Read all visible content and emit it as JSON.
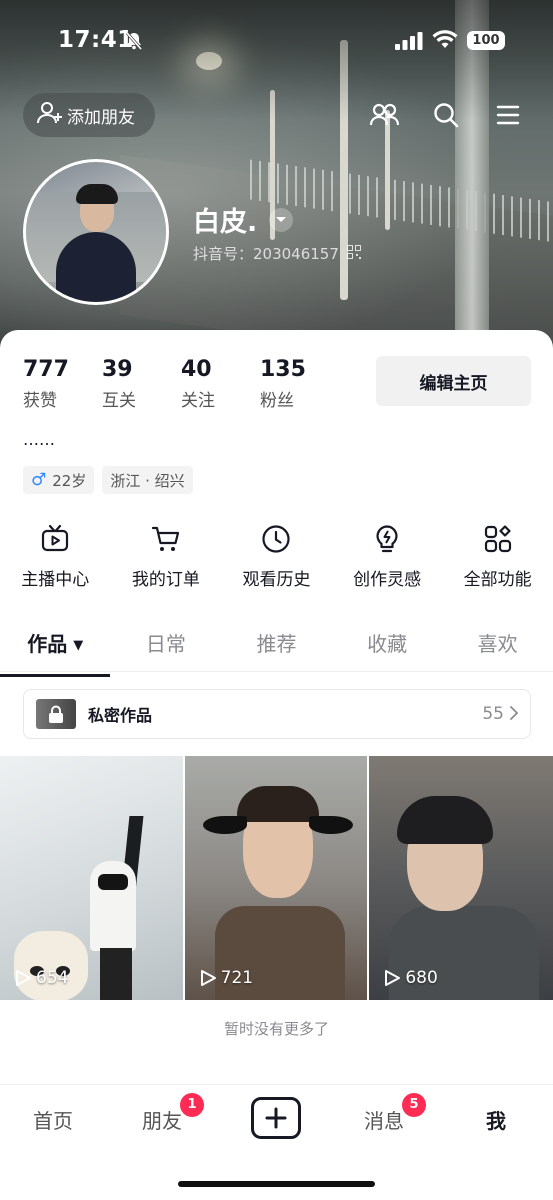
{
  "status_bar": {
    "time": "17:41",
    "battery": "100"
  },
  "header": {
    "add_friend_label": "添加朋友",
    "icons": [
      "friends-icon",
      "search-icon",
      "menu-icon"
    ]
  },
  "profile": {
    "name": "白皮.",
    "douyin_id": "抖音号：203046157"
  },
  "stats": [
    {
      "value": "777",
      "label": "获赞"
    },
    {
      "value": "39",
      "label": "互关"
    },
    {
      "value": "40",
      "label": "关注"
    },
    {
      "value": "135",
      "label": "粉丝"
    }
  ],
  "edit_button_label": "编辑主页",
  "bio": "……",
  "tags": {
    "gender_age": "22岁",
    "location": "浙江 · 绍兴"
  },
  "functions": [
    {
      "label": "主播中心",
      "icon": "tv-icon"
    },
    {
      "label": "我的订单",
      "icon": "cart-icon"
    },
    {
      "label": "观看历史",
      "icon": "clock-icon"
    },
    {
      "label": "创作灵感",
      "icon": "bulb-icon"
    },
    {
      "label": "全部功能",
      "icon": "grid-icon"
    }
  ],
  "tabs": [
    "作品",
    "日常",
    "推荐",
    "收藏",
    "喜欢"
  ],
  "private_works": {
    "label": "私密作品",
    "count": "55"
  },
  "videos": [
    {
      "views": "654"
    },
    {
      "views": "721"
    },
    {
      "views": "680"
    }
  ],
  "no_more_text": "暂时没有更多了",
  "bottom_nav": {
    "home": "首页",
    "friends": "朋友",
    "friends_badge": "1",
    "messages": "消息",
    "messages_badge": "5",
    "me": "我"
  },
  "colors": {
    "accent": "#fe2c55",
    "male": "#2f88ff",
    "text": "#161823"
  }
}
